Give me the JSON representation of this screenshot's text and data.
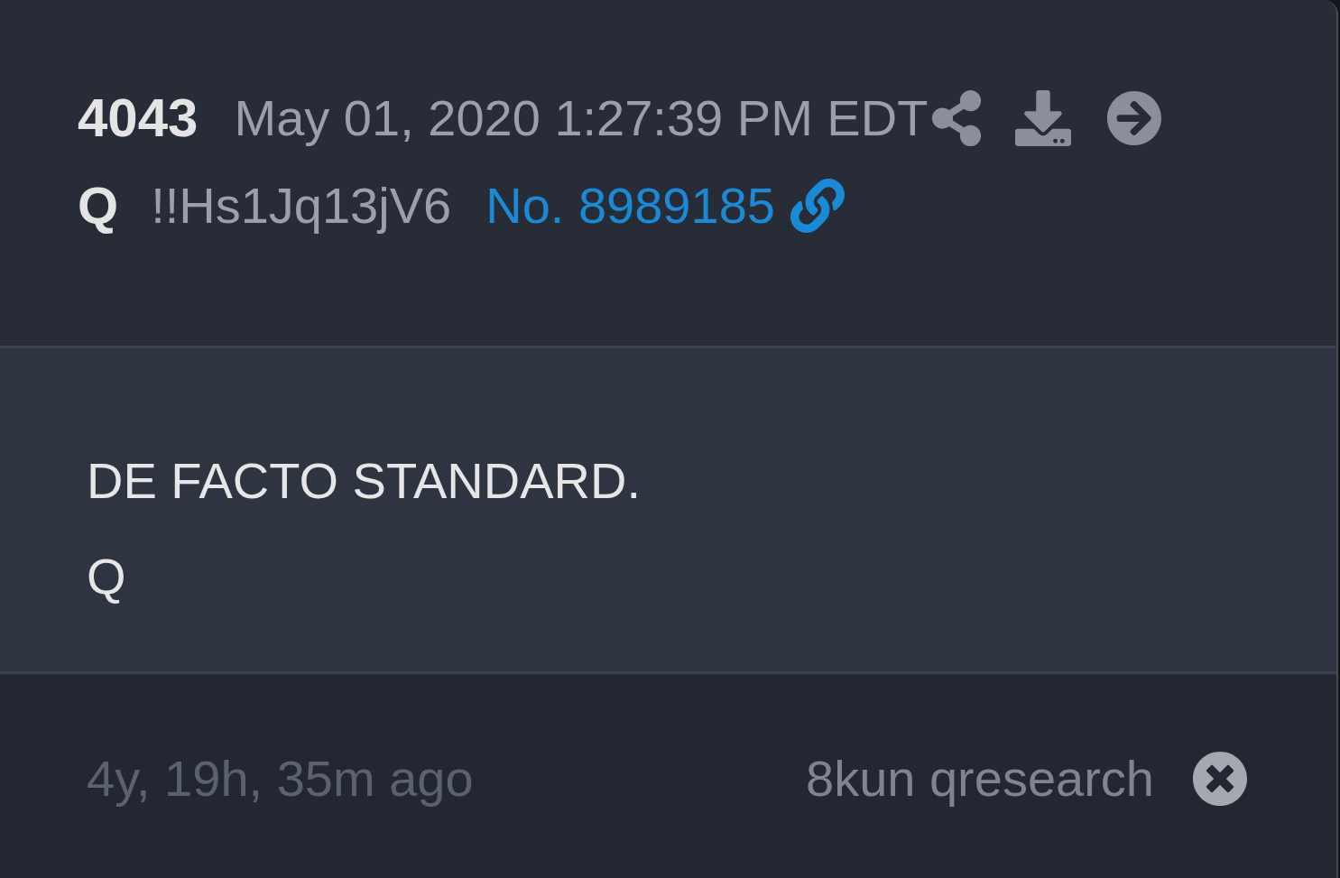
{
  "post": {
    "number": "4043",
    "timestamp": "May 01, 2020 1:27:39 PM EDT",
    "author": "Q",
    "tripcode": "!!Hs1Jq13jV6",
    "post_link": "No. 8989185",
    "lines": [
      "DE FACTO STANDARD.",
      "Q"
    ]
  },
  "footer": {
    "age": "4y, 19h, 35m ago",
    "source": "8kun qresearch"
  }
}
